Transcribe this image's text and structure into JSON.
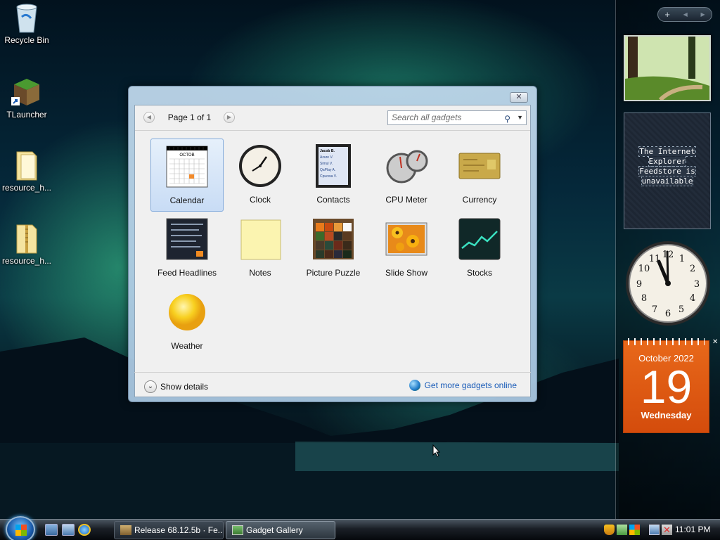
{
  "desktop": {
    "icons": [
      {
        "label": "Recycle Bin"
      },
      {
        "label": "TLauncher"
      },
      {
        "label": "resource_h..."
      },
      {
        "label": "resource_h..."
      }
    ]
  },
  "sidebar": {
    "controls": {
      "add": "+",
      "prev": "◀",
      "next": "▶"
    },
    "feed_gadget": {
      "message_line1": "The Internet Explorer",
      "message_line2": "Feedstore is",
      "message_line3": "unavailable"
    },
    "clock_gadget": {
      "numbers": [
        "12",
        "1",
        "2",
        "3",
        "4",
        "5",
        "6",
        "7",
        "8",
        "9",
        "10",
        "11"
      ]
    },
    "calendar_gadget": {
      "month_year": "October 2022",
      "day": "19",
      "weekday": "Wednesday",
      "close": "✕"
    }
  },
  "gallery": {
    "close": "✕",
    "page_label": "Page 1 of 1",
    "prev": "◀",
    "next": "▶",
    "search_placeholder": "Search all gadgets",
    "gadgets": [
      {
        "label": "Calendar",
        "selected": true
      },
      {
        "label": "Clock"
      },
      {
        "label": "Contacts"
      },
      {
        "label": "CPU Meter"
      },
      {
        "label": "Currency"
      },
      {
        "label": "Feed Headlines"
      },
      {
        "label": "Notes"
      },
      {
        "label": "Picture Puzzle"
      },
      {
        "label": "Slide Show"
      },
      {
        "label": "Stocks"
      },
      {
        "label": "Weather"
      }
    ],
    "calendar_thumb_month": "OCTOB",
    "contacts_thumb_names": [
      "Jacob B.",
      "Azure V.",
      "Simul V.",
      "QaPlay A.",
      "Cpuowa V."
    ],
    "show_details": "Show details",
    "get_more": "Get more gadgets online"
  },
  "taskbar": {
    "buttons": [
      {
        "label": "Release 68.12.5b · Fe..."
      },
      {
        "label": "Gadget Gallery",
        "active": true
      }
    ],
    "clock": "11:01 PM"
  },
  "colors": {
    "calendar_orange": "#e0601a",
    "link_blue": "#1a5cb8",
    "selection_blue": "#c8dcf5"
  }
}
